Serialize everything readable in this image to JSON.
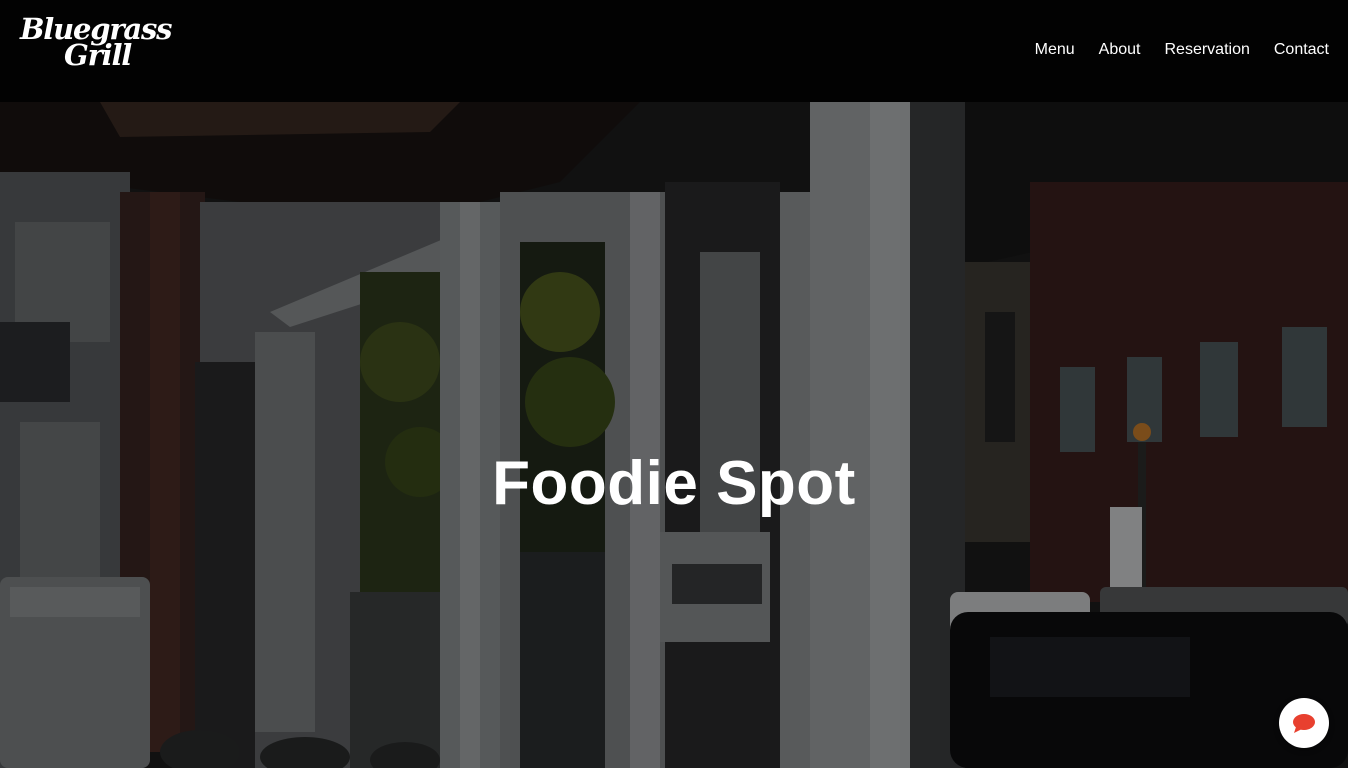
{
  "brand": {
    "logo_line1": "Bluegrass",
    "logo_line2": "Grill"
  },
  "nav": {
    "items": [
      "Menu",
      "About",
      "Reservation",
      "Contact"
    ]
  },
  "hero": {
    "title": "Foodie Spot"
  },
  "chat": {
    "icon": "chat-bubble-icon",
    "color": "#e8402f"
  },
  "colors": {
    "header_bg": "#020202",
    "text": "#ffffff"
  }
}
